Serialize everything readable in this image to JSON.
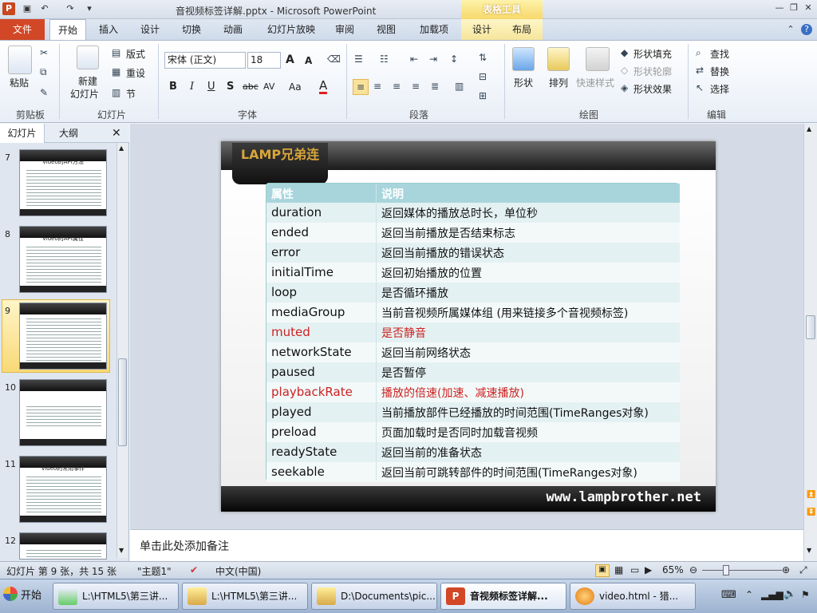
{
  "titlebar": {
    "title": "音视频标签详解.pptx - Microsoft PowerPoint",
    "context_tab_group": "表格工具",
    "app_icon": "P"
  },
  "ribbon_tabs": [
    "文件",
    "开始",
    "插入",
    "设计",
    "切换",
    "动画",
    "幻灯片放映",
    "审阅",
    "视图",
    "加载项",
    "设计",
    "布局"
  ],
  "ribbon": {
    "clipboard": {
      "paste": "粘贴",
      "label": "剪贴板"
    },
    "slides": {
      "new_slide": "新建",
      "new_slide2": "幻灯片",
      "layout": "版式",
      "reset": "重设",
      "section": "节",
      "label": "幻灯片"
    },
    "font": {
      "font_name": "宋体 (正文)",
      "font_size": "18",
      "label": "字体",
      "bold": "B",
      "italic": "I",
      "underline": "U",
      "shadow": "S",
      "strike": "abc",
      "spacing": "AV",
      "case": "Aa",
      "color": "A",
      "grow": "A",
      "shrink": "A"
    },
    "paragraph": {
      "label": "段落"
    },
    "drawing": {
      "shapes": "形状",
      "arrange": "排列",
      "quick_styles": "快速样式",
      "fill": "形状填充",
      "outline": "形状轮廓",
      "effects": "形状效果",
      "label": "绘图"
    },
    "editing": {
      "find": "查找",
      "replace": "替换",
      "select": "选择",
      "label": "编辑"
    }
  },
  "left_panel": {
    "tabs": [
      "幻灯片",
      "大纲"
    ],
    "thumbnails": [
      {
        "num": "7",
        "title": "Video的API方法"
      },
      {
        "num": "8",
        "title": "Video的API属性"
      },
      {
        "num": "9",
        "title": ""
      },
      {
        "num": "10",
        "title": ""
      },
      {
        "num": "11",
        "title": "Video的常用事件"
      },
      {
        "num": "12",
        "title": ""
      }
    ]
  },
  "slide": {
    "logo_text": "LAMP兄弟连",
    "footer_site": "www.lampbrother.net",
    "table": {
      "headers": [
        "属性",
        "说明"
      ],
      "rows": [
        {
          "prop": "duration",
          "desc": "返回媒体的播放总时长，单位秒"
        },
        {
          "prop": "ended",
          "desc": "返回当前播放是否结束标志"
        },
        {
          "prop": "error",
          "desc": "返回当前播放的错误状态"
        },
        {
          "prop": "initialTime",
          "desc": "返回初始播放的位置"
        },
        {
          "prop": "loop",
          "desc": "是否循环播放"
        },
        {
          "prop": "mediaGroup",
          "desc": "当前音视频所属媒体组 (用来链接多个音视频标签)"
        },
        {
          "prop": "muted",
          "desc": "是否静音"
        },
        {
          "prop": "networkState",
          "desc": "返回当前网络状态"
        },
        {
          "prop": "paused",
          "desc": "是否暂停"
        },
        {
          "prop": "playbackRate",
          "desc": "播放的倍速(加速、减速播放)"
        },
        {
          "prop": "played",
          "desc": "当前播放部件已经播放的时间范围(TimeRanges对象)"
        },
        {
          "prop": "preload",
          "desc": "页面加载时是否同时加载音视频"
        },
        {
          "prop": "readyState",
          "desc": "返回当前的准备状态"
        },
        {
          "prop": "seekable",
          "desc": "返回当前可跳转部件的时间范围(TimeRanges对象)"
        }
      ]
    }
  },
  "notes": {
    "placeholder": "单击此处添加备注"
  },
  "statusbar": {
    "slide_info": "幻灯片 第 9 张，共 15 张",
    "theme": "\"主题1\"",
    "language": "中文(中国)",
    "zoom": "65%"
  },
  "taskbar": {
    "start": "开始",
    "tasks": [
      "L:\\HTML5\\第三讲...",
      "L:\\HTML5\\第三讲...",
      "D:\\Documents\\pic...",
      "音视频标签详解...",
      "video.html - 猎..."
    ]
  },
  "colors": {
    "accent": "#d24726",
    "highlight_red": "#cc2222",
    "table_header": "#a8d5dc"
  }
}
